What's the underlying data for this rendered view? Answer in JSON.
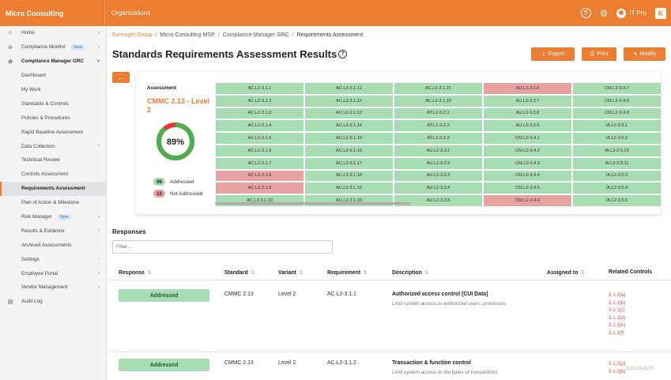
{
  "app": {
    "brand": "Micro Consulting",
    "org_label": "Organizations",
    "user_name": "IT Pro",
    "help_glyph": "?",
    "settings_glyph": "⚙",
    "brand_badge": "K"
  },
  "sidebar": {
    "items": [
      {
        "label": "Home",
        "icon": "home-icon",
        "level": "top",
        "chev": true
      },
      {
        "label": "Compliance Monitor",
        "icon": "check-circle-icon",
        "level": "top",
        "badge": "New",
        "chev": true
      },
      {
        "label": "Compliance Manager GRC",
        "icon": "check-circle-icon",
        "level": "top",
        "bold": true,
        "chev": true,
        "expanded": true
      },
      {
        "label": "Dashboard",
        "level": "sub"
      },
      {
        "label": "My Work",
        "level": "sub"
      },
      {
        "label": "Standards & Controls",
        "level": "sub"
      },
      {
        "label": "Policies & Procedures",
        "level": "sub"
      },
      {
        "label": "Rapid Baseline Assessment",
        "level": "sub"
      },
      {
        "label": "Data Collection",
        "level": "sub",
        "chev": true
      },
      {
        "label": "Technical Review",
        "level": "sub"
      },
      {
        "label": "Controls Assessment",
        "level": "sub"
      },
      {
        "label": "Requirements Assessment",
        "level": "sub",
        "active": true
      },
      {
        "label": "Plan of Action & Milestone",
        "level": "sub"
      },
      {
        "label": "Risk Manager",
        "level": "sub",
        "badge": "New",
        "chev": true
      },
      {
        "label": "Results & Evidence",
        "level": "sub",
        "chev": true
      },
      {
        "label": "Archived Assessments",
        "level": "sub"
      },
      {
        "label": "Settings",
        "level": "sub",
        "chev": true
      },
      {
        "label": "Employee Portal",
        "level": "sub",
        "chev": true
      },
      {
        "label": "Vendor Management",
        "level": "sub",
        "chev": true
      },
      {
        "label": "Audit Log",
        "icon": "clipboard-icon",
        "level": "top"
      }
    ]
  },
  "breadcrumb": {
    "items": [
      "Foresight Group",
      "Micro Consulting MSP",
      "Compliance Manager GRC",
      "Requirements Assessment"
    ],
    "separator": "/"
  },
  "page": {
    "title": "Standards Requirements Assessment Results",
    "export_label": "Export",
    "print_label": "Print",
    "modify_label": "Modify",
    "back_glyph": "←"
  },
  "assessment": {
    "label": "Assessment",
    "name": "CMMC 2.13 - Level 2",
    "percent": 89,
    "percent_label": "89%",
    "addressed_count": "98",
    "addressed_label": "Addressed",
    "not_addressed_count": "12",
    "not_addressed_label": "Not Addressed",
    "colors": {
      "addressed": "#a8dcb2",
      "not_addressed": "#e9a2a2",
      "accent": "#ed7d31",
      "donut_green": "#4caf50",
      "donut_red": "#e53935"
    },
    "grid": [
      [
        "AC.L2-3.1.1",
        "g"
      ],
      [
        "AC.L2-3.1.11",
        "g"
      ],
      [
        "AC.L2-3.1.21",
        "g"
      ],
      [
        "AU.L2-3.3.6",
        "r"
      ],
      [
        "CM.L2-3.4.7",
        "g"
      ],
      [
        "AC.L2-3.1.2",
        "g"
      ],
      [
        "AC.L2-3.1.12",
        "g"
      ],
      [
        "AC.L2-3.1.22",
        "g"
      ],
      [
        "AU.L2-3.3.7",
        "g"
      ],
      [
        "CM.L2-3.4.8",
        "g"
      ],
      [
        "AC.L2-3.1.3",
        "g"
      ],
      [
        "AC.L2-3.1.13",
        "g"
      ],
      [
        "AT.L2-3.2.1",
        "g"
      ],
      [
        "AU.L2-3.3.8",
        "g"
      ],
      [
        "CM.L2-3.4.9",
        "g"
      ],
      [
        "AC.L2-3.1.4",
        "g"
      ],
      [
        "AC.L2-3.1.14",
        "g"
      ],
      [
        "AT.L2-3.2.2",
        "g"
      ],
      [
        "AU.L2-3.3.9",
        "g"
      ],
      [
        "IA.L2-3.5.1",
        "g"
      ],
      [
        "AC.L2-3.1.5",
        "g"
      ],
      [
        "AC.L2-3.1.15",
        "g"
      ],
      [
        "AT.L2-3.2.3",
        "g"
      ],
      [
        "CM.L2-3.4.1",
        "g"
      ],
      [
        "IA.L2-3.5.2",
        "g"
      ],
      [
        "AC.L2-3.1.6",
        "g"
      ],
      [
        "AC.L2-3.1.16",
        "g"
      ],
      [
        "AU.L2-3.3.1",
        "g"
      ],
      [
        "CM.L2-3.4.2",
        "g"
      ],
      [
        "IA.L2-3.5.10",
        "g"
      ],
      [
        "AC.L2-3.1.7",
        "g"
      ],
      [
        "AC.L2-3.1.17",
        "g"
      ],
      [
        "AU.L2-3.3.2",
        "g"
      ],
      [
        "CM.L2-3.4.3",
        "g"
      ],
      [
        "IA.L2-3.5.11",
        "g"
      ],
      [
        "AC.L2-3.1.8",
        "r"
      ],
      [
        "AC.L2-3.1.18",
        "g"
      ],
      [
        "AU.L2-3.3.3",
        "g"
      ],
      [
        "CM.L2-3.4.4",
        "g"
      ],
      [
        "IA.L2-3.5.3",
        "g"
      ],
      [
        "AC.L2-3.1.9",
        "r"
      ],
      [
        "AC.L2-3.1.19",
        "g"
      ],
      [
        "AU.L2-3.3.4",
        "g"
      ],
      [
        "CM.L2-3.4.5",
        "g"
      ],
      [
        "IA.L2-3.5.4",
        "g"
      ],
      [
        "AC.L2-3.1.10",
        "g"
      ],
      [
        "AC.L2-3.1.20",
        "g"
      ],
      [
        "AU.L2-3.3.5",
        "g"
      ],
      [
        "CM.L2-3.4.6",
        "r"
      ],
      [
        "IA.L2-3.5.5",
        "g"
      ]
    ]
  },
  "responses": {
    "title": "Responses",
    "filter_placeholder": "Filter...",
    "columns": {
      "response": "Response",
      "standard": "Standard",
      "variant": "Variant",
      "requirement": "Requirement",
      "description": "Description",
      "assigned": "Assigned to",
      "related": "Related Controls",
      "sort_glyph": "⇅"
    },
    "rows": [
      {
        "response": "Addressed",
        "standard": "CMMC 2.13",
        "variant": "Level 2",
        "requirement": "AC.L2-3.1.1",
        "desc_title": "Authorized access control [CUI Data]",
        "desc_sub": "Limit system access to authorized users, processes.",
        "controls": [
          "3.1.1[a]",
          "3.1.1[b]",
          "3.1.1[c]",
          "3.1.1[d]",
          "3.1.1[e]",
          "3.1.1[f]"
        ]
      },
      {
        "response": "Addressed",
        "standard": "CMMC 2.13",
        "variant": "Level 2",
        "requirement": "AC.L2-3.1.2",
        "desc_title": "Transaction & function control",
        "desc_sub": "Limit system access to the types of transactions",
        "controls": [
          "3.1.2[a]",
          "3.1.2[b]"
        ]
      }
    ]
  },
  "build": "3.11.03-2120"
}
